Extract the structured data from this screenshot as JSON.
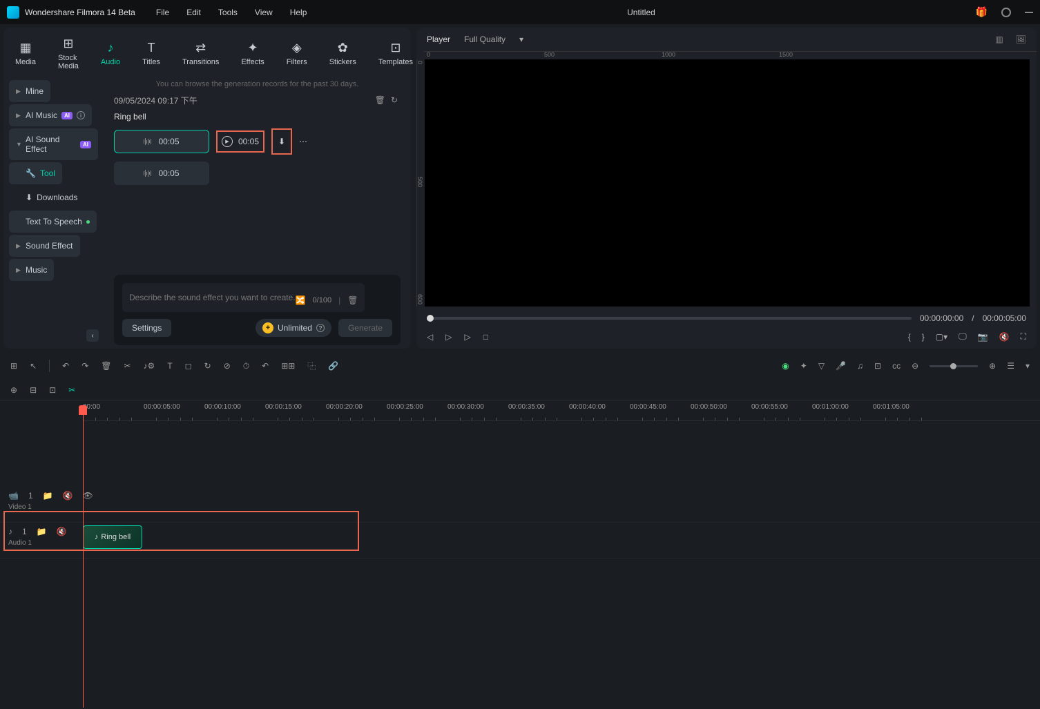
{
  "app": {
    "title": "Wondershare Filmora 14 Beta",
    "document": "Untitled"
  },
  "menubar": [
    "File",
    "Edit",
    "Tools",
    "View",
    "Help"
  ],
  "tabs": [
    {
      "label": "Media"
    },
    {
      "label": "Stock Media"
    },
    {
      "label": "Audio",
      "active": true
    },
    {
      "label": "Titles"
    },
    {
      "label": "Transitions"
    },
    {
      "label": "Effects"
    },
    {
      "label": "Filters"
    },
    {
      "label": "Stickers"
    },
    {
      "label": "Templates"
    }
  ],
  "sidebar": {
    "items": [
      {
        "label": "Mine",
        "chevron": true,
        "hl": true
      },
      {
        "label": "AI Music",
        "chevron": true,
        "ai": true,
        "info": true,
        "hl": true
      },
      {
        "label": "AI Sound Effect",
        "chevron": true,
        "ai": true,
        "hl": true,
        "expanded": true
      },
      {
        "label": "Tool",
        "tool": true,
        "active": true
      },
      {
        "label": "Downloads",
        "dl": true
      },
      {
        "label": "Text To Speech",
        "dot": true,
        "hl": true
      },
      {
        "label": "Sound Effect",
        "chevron": true,
        "hl": true
      },
      {
        "label": "Music",
        "chevron": true,
        "hl": true
      }
    ]
  },
  "gen": {
    "hint": "You can browse the generation records for the past 30 days.",
    "date": "09/05/2024 09:17 下午",
    "title": "Ring bell",
    "clip1": "00:05",
    "play_dur": "00:05",
    "clip2": "00:05"
  },
  "prompt": {
    "placeholder": "Describe the sound effect you want to create.",
    "counter": "0/100",
    "settings": "Settings",
    "unlimited": "Unlimited",
    "generate": "Generate"
  },
  "player": {
    "tab": "Player",
    "quality": "Full Quality",
    "ruler_h": [
      "0",
      "500",
      "1000",
      "1500"
    ],
    "ruler_v": [
      "0",
      "500",
      "600"
    ],
    "time_current": "00:00:00:00",
    "time_sep": "/",
    "time_total": "00:00:05:00"
  },
  "timeline": {
    "ticks": [
      "00:00",
      "00:00:05:00",
      "00:00:10:00",
      "00:00:15:00",
      "00:00:20:00",
      "00:00:25:00",
      "00:00:30:00",
      "00:00:35:00",
      "00:00:40:00",
      "00:00:45:00",
      "00:00:50:00",
      "00:00:55:00",
      "00:01:00:00",
      "00:01:05:00"
    ],
    "video_track": {
      "num": "1",
      "label": "Video 1"
    },
    "audio_track": {
      "num": "1",
      "label": "Audio 1",
      "clip": "Ring bell"
    }
  }
}
